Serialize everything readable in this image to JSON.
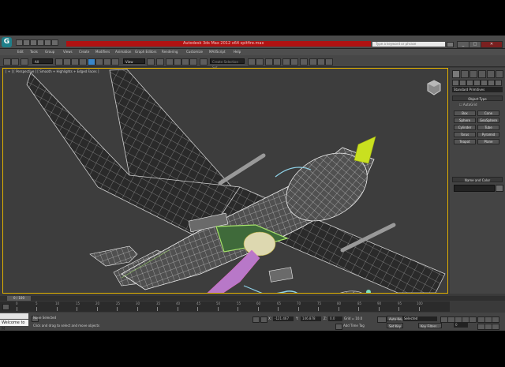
{
  "titlebar": {
    "title": "Autodesk 3ds Max 2012 x64   spitfire.max",
    "search_placeholder": "Type a keyword or phrase"
  },
  "menu": [
    "Edit",
    "Tools",
    "Group",
    "Views",
    "Create",
    "Modifiers",
    "Animation",
    "Graph Editors",
    "Rendering",
    "Customize",
    "MAXScript",
    "Help"
  ],
  "toolbar": {
    "filter_value": "All",
    "refcoord_value": "View",
    "selection_set_placeholder": "Create Selection Set"
  },
  "viewport": {
    "label": "[ + ] [ Perspective ] [ Smooth + Highlights + Edged Faces ]"
  },
  "command_panel": {
    "category_value": "Standard Primitives",
    "object_type_title": "Object Type",
    "autogrid_label": "AutoGrid",
    "primitives": [
      "Box",
      "Cone",
      "Sphere",
      "GeoSphere",
      "Cylinder",
      "Tube",
      "Torus",
      "Pyramid",
      "Teapot",
      "Plane"
    ],
    "name_color_title": "Name and Color"
  },
  "timeline": {
    "slider_label": "0 / 100",
    "ticks": [
      "0",
      "5",
      "10",
      "15",
      "20",
      "25",
      "30",
      "35",
      "40",
      "45",
      "50",
      "55",
      "60",
      "65",
      "70",
      "75",
      "80",
      "85",
      "90",
      "95",
      "100"
    ]
  },
  "status": {
    "listener_text": "Welcome to M",
    "selection_status": "None Selected",
    "prompt": "Click and drag to select and move objects",
    "x_label": "X:",
    "x_value": "-121.467",
    "y_label": "Y:",
    "y_value": "146.878",
    "z_label": "Z:",
    "z_value": "0.0",
    "grid": "Grid = 10.0",
    "add_time_tag": "Add Time Tag",
    "auto_key": "Auto Key",
    "set_key": "Set Key",
    "selected": "Selected",
    "key_filters": "Key Filters...",
    "frame": "0"
  },
  "colors": {
    "accent": "#e0b000",
    "title_red": "#b01212",
    "wire": "#d8d8d8",
    "selected_wire": "#a7e36a",
    "nose_cone": "#c9e020",
    "cyan_mesh": "#8fd2e8",
    "pink_mesh": "#d96cc5"
  }
}
